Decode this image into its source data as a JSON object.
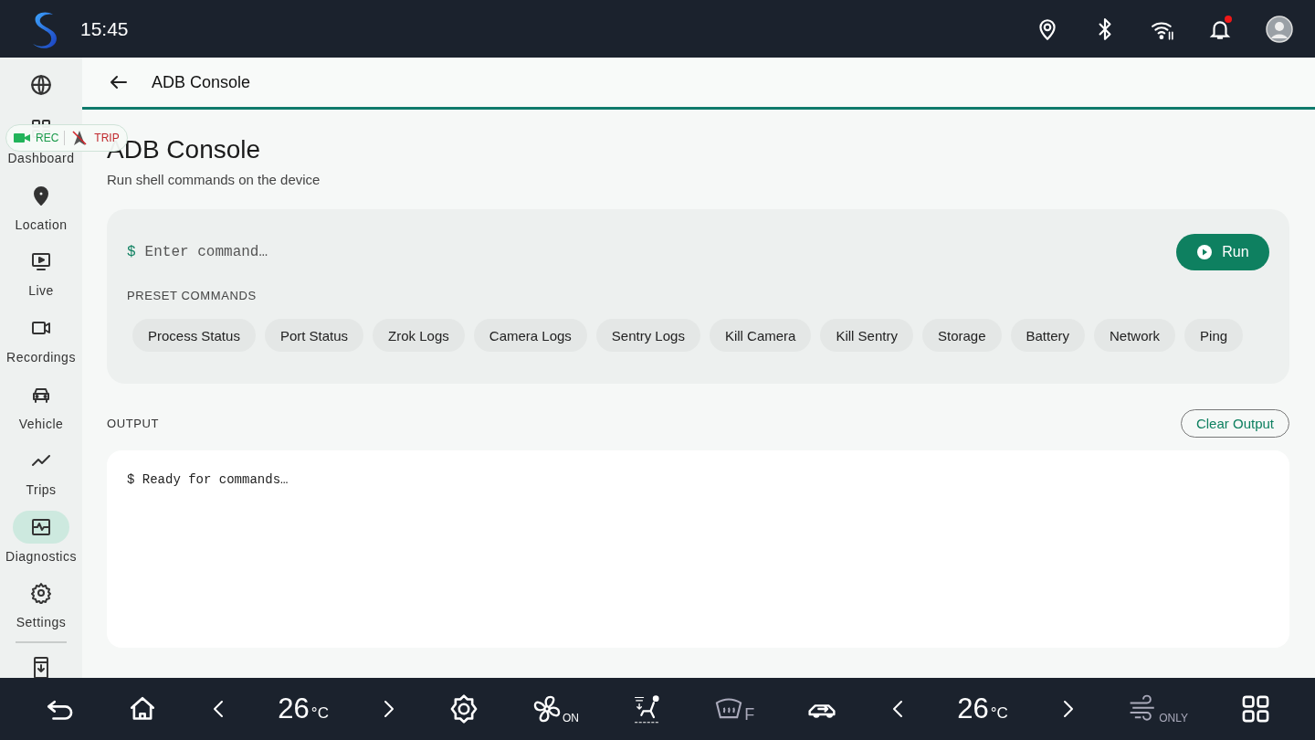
{
  "status_bar": {
    "time": "15:45",
    "notification_badge": true
  },
  "sidebar": {
    "items": [
      {
        "label": "Dashboard",
        "selected": false
      },
      {
        "label": "Location",
        "selected": false
      },
      {
        "label": "Live",
        "selected": false
      },
      {
        "label": "Recordings",
        "selected": false
      },
      {
        "label": "Vehicle",
        "selected": false
      },
      {
        "label": "Trips",
        "selected": false
      },
      {
        "label": "Diagnostics",
        "selected": true
      },
      {
        "label": "Settings",
        "selected": false
      }
    ]
  },
  "recording_pill": {
    "rec_label": "REC",
    "trip_label": "TRIP"
  },
  "header": {
    "title": "ADB Console"
  },
  "page": {
    "title": "ADB Console",
    "subtitle": "Run shell commands on the device"
  },
  "console": {
    "prompt": "$",
    "placeholder": "Enter command…",
    "run_button": "Run",
    "presets_label": "PRESET COMMANDS",
    "presets": [
      "Process Status",
      "Port Status",
      "Zrok Logs",
      "Camera Logs",
      "Sentry Logs",
      "Kill Camera",
      "Kill Sentry",
      "Storage",
      "Battery",
      "Network",
      "Ping"
    ]
  },
  "output": {
    "label": "OUTPUT",
    "clear_button": "Clear Output",
    "text": "$ Ready for commands…"
  },
  "climate_bar": {
    "left_temp": "26",
    "left_unit": "°C",
    "fan_label": "ON",
    "defrost_label": "F",
    "right_temp": "26",
    "right_unit": "°C",
    "airflow_label": "ONLY"
  }
}
